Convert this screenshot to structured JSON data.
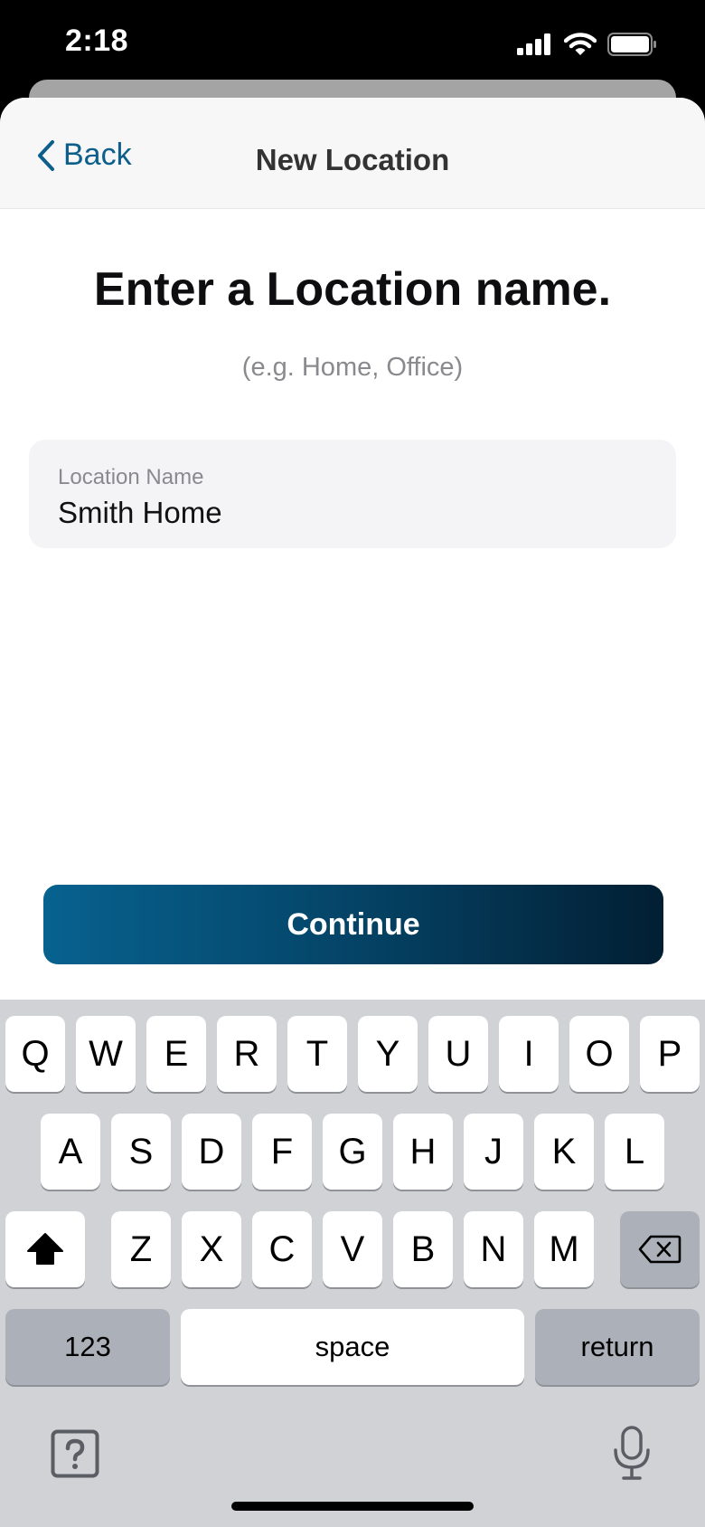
{
  "status_bar": {
    "time": "2:18",
    "icons": [
      "signal-icon",
      "wifi-icon",
      "battery-icon"
    ]
  },
  "nav": {
    "back_label": "Back",
    "title": "New Location"
  },
  "main": {
    "heading": "Enter a Location name.",
    "hint": "(e.g. Home, Office)",
    "field": {
      "label": "Location Name",
      "value": "Smith Home"
    },
    "continue_label": "Continue"
  },
  "keyboard": {
    "row1": [
      "Q",
      "W",
      "E",
      "R",
      "T",
      "Y",
      "U",
      "I",
      "O",
      "P"
    ],
    "row2": [
      "A",
      "S",
      "D",
      "F",
      "G",
      "H",
      "J",
      "K",
      "L"
    ],
    "row3": [
      "Z",
      "X",
      "C",
      "V",
      "B",
      "N",
      "M"
    ],
    "numbers_label": "123",
    "space_label": "space",
    "return_label": "return",
    "icons": [
      "shift-icon",
      "delete-icon",
      "help-icon",
      "microphone-icon"
    ]
  },
  "colors": {
    "accent": "#0b5f8a",
    "button_start": "#07628f",
    "button_end": "#021f33",
    "keyboard_bg": "#d0d2d6"
  }
}
